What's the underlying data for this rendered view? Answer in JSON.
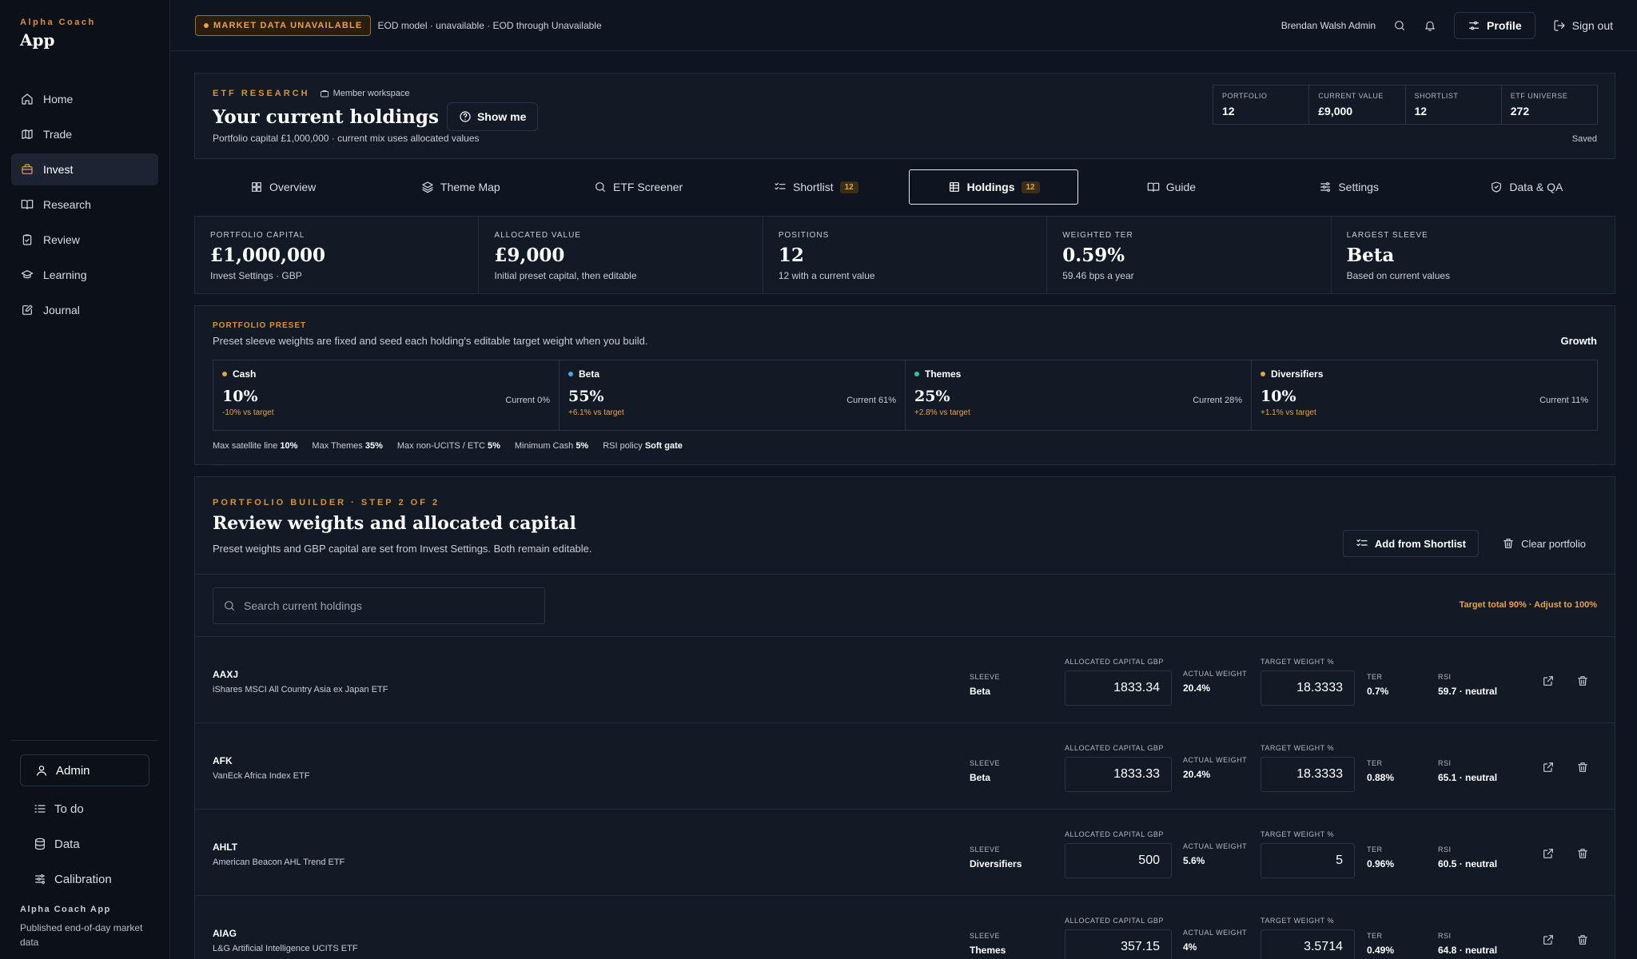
{
  "brand": {
    "sub": "Alpha Coach",
    "main": "App"
  },
  "nav": [
    {
      "label": "Home",
      "icon": "home-icon"
    },
    {
      "label": "Trade",
      "icon": "map-icon"
    },
    {
      "label": "Invest",
      "icon": "briefcase-icon",
      "active": true
    },
    {
      "label": "Research",
      "icon": "book-icon"
    },
    {
      "label": "Review",
      "icon": "clipboard-check-icon"
    },
    {
      "label": "Learning",
      "icon": "graduation-cap-icon"
    },
    {
      "label": "Journal",
      "icon": "notebook-pen-icon"
    }
  ],
  "admin": {
    "label": "Admin"
  },
  "sub_nav": [
    {
      "label": "To do",
      "icon": "list-todo-icon"
    },
    {
      "label": "Data",
      "icon": "database-icon"
    },
    {
      "label": "Calibration",
      "icon": "sliders-icon"
    }
  ],
  "sidebar_footer": {
    "title": "Alpha Coach App",
    "text": "Published end-of-day market data"
  },
  "topbar": {
    "badge": "MARKET DATA UNAVAILABLE",
    "status_text": "EOD model · unavailable · EOD through Unavailable",
    "user": "Brendan Walsh Admin",
    "profile_label": "Profile",
    "signout_label": "Sign out"
  },
  "header": {
    "eyebrow": "ETF RESEARCH",
    "workspace": "Member workspace",
    "title": "Your current holdings",
    "show_me": "Show me",
    "subtitle": "Portfolio capital £1,000,000 · current mix uses allocated values",
    "saved": "Saved",
    "stats": [
      {
        "label": "PORTFOLIO",
        "value": "12"
      },
      {
        "label": "CURRENT VALUE",
        "value": "£9,000"
      },
      {
        "label": "SHORTLIST",
        "value": "12"
      },
      {
        "label": "ETF UNIVERSE",
        "value": "272"
      }
    ]
  },
  "tabs": [
    {
      "label": "Overview",
      "icon": "layout-grid-icon",
      "badge": ""
    },
    {
      "label": "Theme Map",
      "icon": "layers-icon",
      "badge": ""
    },
    {
      "label": "ETF Screener",
      "icon": "search-icon",
      "badge": ""
    },
    {
      "label": "Shortlist",
      "icon": "list-checks-icon",
      "badge": "12"
    },
    {
      "label": "Holdings",
      "icon": "table-icon",
      "badge": "12",
      "active": true
    },
    {
      "label": "Guide",
      "icon": "book-open-icon",
      "badge": ""
    },
    {
      "label": "Settings",
      "icon": "sliders-icon",
      "badge": ""
    },
    {
      "label": "Data & QA",
      "icon": "shield-check-icon",
      "badge": ""
    }
  ],
  "kpis": [
    {
      "label": "PORTFOLIO CAPITAL",
      "value": "£1,000,000",
      "note": "Invest Settings · GBP"
    },
    {
      "label": "ALLOCATED VALUE",
      "value": "£9,000",
      "note": "Initial preset capital, then editable"
    },
    {
      "label": "POSITIONS",
      "value": "12",
      "note": "12 with a current value"
    },
    {
      "label": "WEIGHTED TER",
      "value": "0.59%",
      "note": "59.46 bps a year"
    },
    {
      "label": "LARGEST SLEEVE",
      "value": "Beta",
      "note": "Based on current values"
    }
  ],
  "preset": {
    "eyebrow": "PORTFOLIO PRESET",
    "subtitle": "Preset sleeve weights are fixed and seed each holding's editable target weight when you build.",
    "name": "Growth",
    "sleeves": [
      {
        "name": "Cash",
        "color": "#e0a640",
        "pct": "10%",
        "current": "Current 0%",
        "delta": "-10% vs target"
      },
      {
        "name": "Beta",
        "color": "#4aa3e8",
        "pct": "55%",
        "current": "Current 61%",
        "delta": "+6.1% vs target"
      },
      {
        "name": "Themes",
        "color": "#2ec4a0",
        "pct": "25%",
        "current": "Current 28%",
        "delta": "+2.8% vs target"
      },
      {
        "name": "Diversifiers",
        "color": "#e0a640",
        "pct": "10%",
        "current": "Current 11%",
        "delta": "+1.1% vs target"
      }
    ],
    "limits": [
      {
        "label": "Max satellite line",
        "value": "10%"
      },
      {
        "label": "Max Themes",
        "value": "35%"
      },
      {
        "label": "Max non-UCITS / ETC",
        "value": "5%"
      },
      {
        "label": "Minimum Cash",
        "value": "5%"
      },
      {
        "label": "RSI policy",
        "value": "Soft gate"
      }
    ]
  },
  "builder": {
    "eyebrow": "PORTFOLIO BUILDER · STEP 2 OF 2",
    "title": "Review weights and allocated capital",
    "subtitle": "Preset weights and GBP capital are set from Invest Settings. Both remain editable.",
    "add_label": "Add from Shortlist",
    "clear_label": "Clear portfolio",
    "search_placeholder": "Search current holdings",
    "warning": "Target total 90% · Adjust to 100%",
    "col_labels": {
      "sleeve": "SLEEVE",
      "alloc": "ALLOCATED CAPITAL GBP",
      "actual": "ACTUAL WEIGHT",
      "target": "TARGET WEIGHT %",
      "ter": "TER",
      "rsi": "RSI"
    },
    "rows": [
      {
        "ticker": "AAXJ",
        "name": "iShares MSCI All Country Asia ex Japan ETF",
        "sleeve": "Beta",
        "alloc": "1833.34",
        "actual": "20.4%",
        "target": "18.3333",
        "ter": "0.7%",
        "rsi": "59.7 · neutral"
      },
      {
        "ticker": "AFK",
        "name": "VanEck Africa Index ETF",
        "sleeve": "Beta",
        "alloc": "1833.33",
        "actual": "20.4%",
        "target": "18.3333",
        "ter": "0.88%",
        "rsi": "65.1 · neutral"
      },
      {
        "ticker": "AHLT",
        "name": "American Beacon AHL Trend ETF",
        "sleeve": "Diversifiers",
        "alloc": "500",
        "actual": "5.6%",
        "target": "5",
        "ter": "0.96%",
        "rsi": "60.5 · neutral"
      },
      {
        "ticker": "AIAG",
        "name": "L&G Artificial Intelligence UCITS ETF",
        "sleeve": "Themes",
        "alloc": "357.15",
        "actual": "4%",
        "target": "3.5714",
        "ter": "0.49%",
        "rsi": "64.8 · neutral"
      }
    ]
  }
}
